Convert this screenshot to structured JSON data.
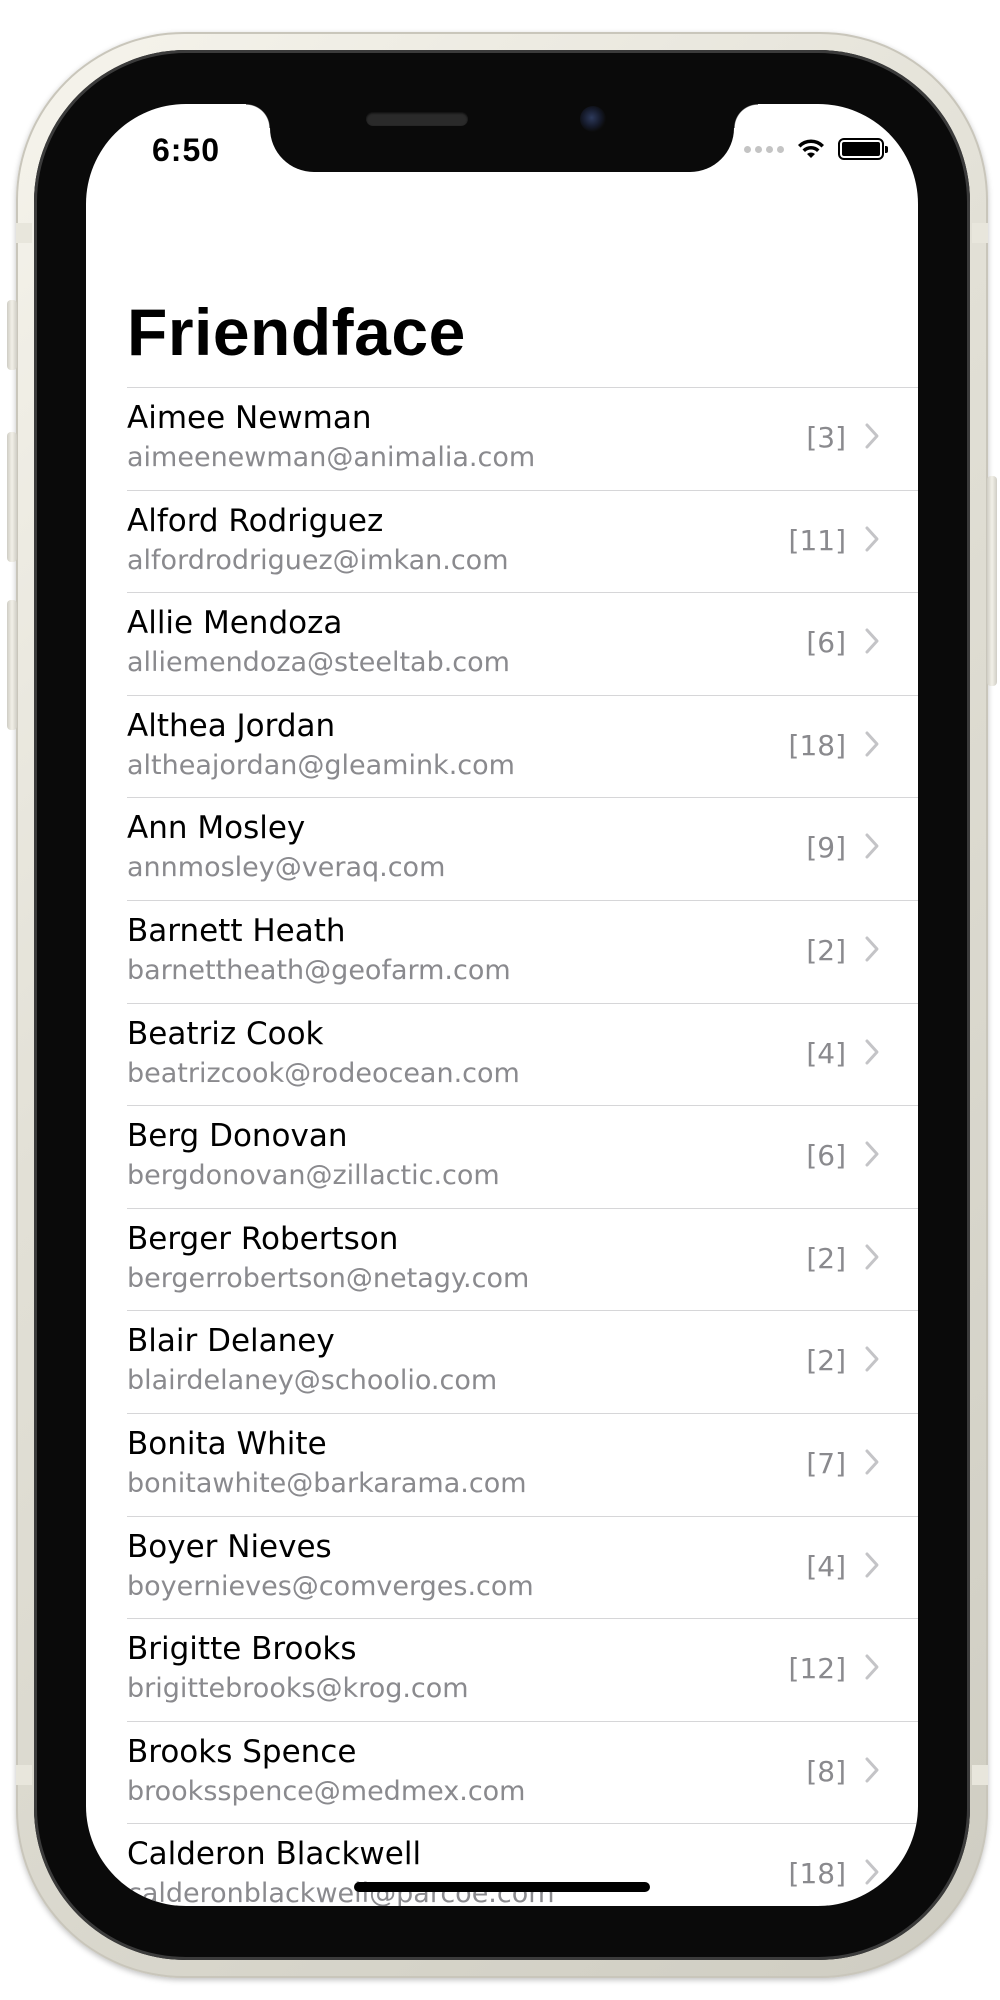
{
  "status_bar": {
    "time": "6:50",
    "icons": [
      "cellular-signal-icon",
      "wifi-icon",
      "battery-icon"
    ]
  },
  "nav": {
    "title": "Friendface"
  },
  "friends": [
    {
      "name": "Aimee Newman",
      "email": "aimeenewman@animalia.com",
      "count": "[3]"
    },
    {
      "name": "Alford Rodriguez",
      "email": "alfordrodriguez@imkan.com",
      "count": "[11]"
    },
    {
      "name": "Allie Mendoza",
      "email": "alliemendoza@steeltab.com",
      "count": "[6]"
    },
    {
      "name": "Althea Jordan",
      "email": "altheajordan@gleamink.com",
      "count": "[18]"
    },
    {
      "name": "Ann Mosley",
      "email": "annmosley@veraq.com",
      "count": "[9]"
    },
    {
      "name": "Barnett Heath",
      "email": "barnettheath@geofarm.com",
      "count": "[2]"
    },
    {
      "name": "Beatriz Cook",
      "email": "beatrizcook@rodeocean.com",
      "count": "[4]"
    },
    {
      "name": "Berg Donovan",
      "email": "bergdonovan@zillactic.com",
      "count": "[6]"
    },
    {
      "name": "Berger Robertson",
      "email": "bergerrobertson@netagy.com",
      "count": "[2]"
    },
    {
      "name": "Blair Delaney",
      "email": "blairdelaney@schoolio.com",
      "count": "[2]"
    },
    {
      "name": "Bonita White",
      "email": "bonitawhite@barkarama.com",
      "count": "[7]"
    },
    {
      "name": "Boyer Nieves",
      "email": "boyernieves@comverges.com",
      "count": "[4]"
    },
    {
      "name": "Brigitte Brooks",
      "email": "brigittebrooks@krog.com",
      "count": "[12]"
    },
    {
      "name": "Brooks Spence",
      "email": "brooksspence@medmex.com",
      "count": "[8]"
    },
    {
      "name": "Calderon Blackwell",
      "email": "calderonblackwell@parcoe.com",
      "count": "[18]"
    }
  ],
  "colors": {
    "text_primary": "#000000",
    "text_secondary": "#8a8a8e",
    "separator": "#d6d6d8",
    "chevron": "#c4c4c7"
  }
}
